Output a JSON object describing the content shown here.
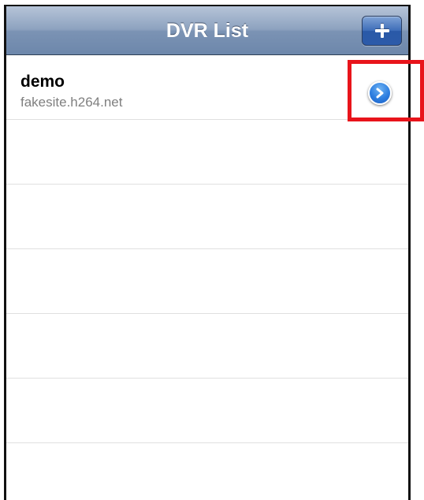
{
  "nav_bar": {
    "title": "DVR List",
    "add_button_icon": "plus-icon"
  },
  "list": {
    "items": [
      {
        "title": "demo",
        "subtitle": "fakesite.h264.net",
        "accessory_icon": "chevron-right-icon"
      }
    ],
    "empty_rows": 6
  },
  "colors": {
    "nav_bar": "#7b93b4",
    "add_button": "#3d6cb8",
    "disclosure_button": "#2d7ee0",
    "highlight": "#e8141b",
    "subtitle_text": "#7f7f7f"
  }
}
